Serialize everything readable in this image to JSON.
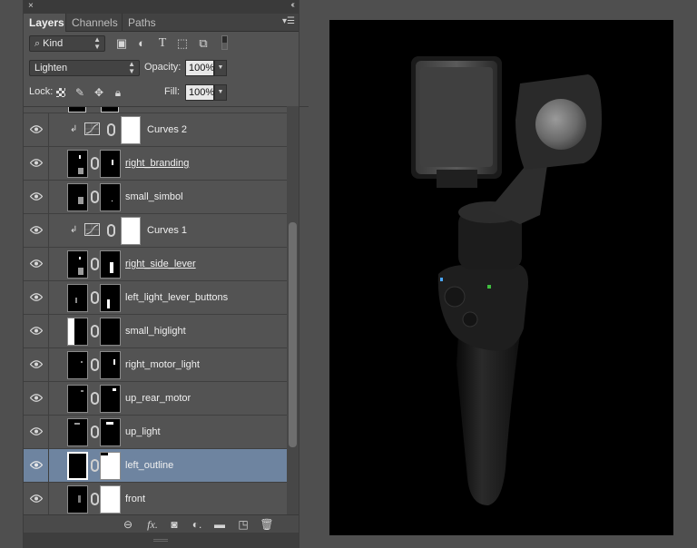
{
  "panel": {
    "close_glyph": "×",
    "collapse_glyph": "‹‹",
    "tabs": [
      {
        "label": "Layers",
        "active": true
      },
      {
        "label": "Channels",
        "active": false
      },
      {
        "label": "Paths",
        "active": false
      }
    ],
    "filter": {
      "kind_label": "Kind"
    },
    "blend": {
      "mode": "Lighten",
      "opacity_label": "Opacity:",
      "opacity_value": "100%"
    },
    "lock": {
      "lock_label": "Lock:",
      "fill_label": "Fill:",
      "fill_value": "100%"
    },
    "layers": [
      {
        "name": "Curves 2",
        "type": "adjustment"
      },
      {
        "name": "right_branding",
        "type": "masked",
        "underline": true
      },
      {
        "name": "small_simbol",
        "type": "masked"
      },
      {
        "name": "Curves 1",
        "type": "adjustment"
      },
      {
        "name": "right_side_lever",
        "type": "masked",
        "underline": true
      },
      {
        "name": "left_light_lever_buttons",
        "type": "masked"
      },
      {
        "name": "small_higlight",
        "type": "masked"
      },
      {
        "name": "right_motor_light",
        "type": "masked"
      },
      {
        "name": "up_rear_motor",
        "type": "masked"
      },
      {
        "name": "up_light",
        "type": "masked"
      },
      {
        "name": "left_outline",
        "type": "masked",
        "selected": true
      },
      {
        "name": "front",
        "type": "masked"
      }
    ],
    "bottom_icons": [
      "link-icon",
      "fx-icon",
      "add-mask-icon",
      "adjustment-icon",
      "folder-icon",
      "new-layer-icon",
      "trash-icon"
    ]
  },
  "colors": {
    "panel_bg": "#535353",
    "selected_row": "#6e84a0",
    "canvas_bg": "#000000",
    "app_bg": "#4f4f4f"
  }
}
